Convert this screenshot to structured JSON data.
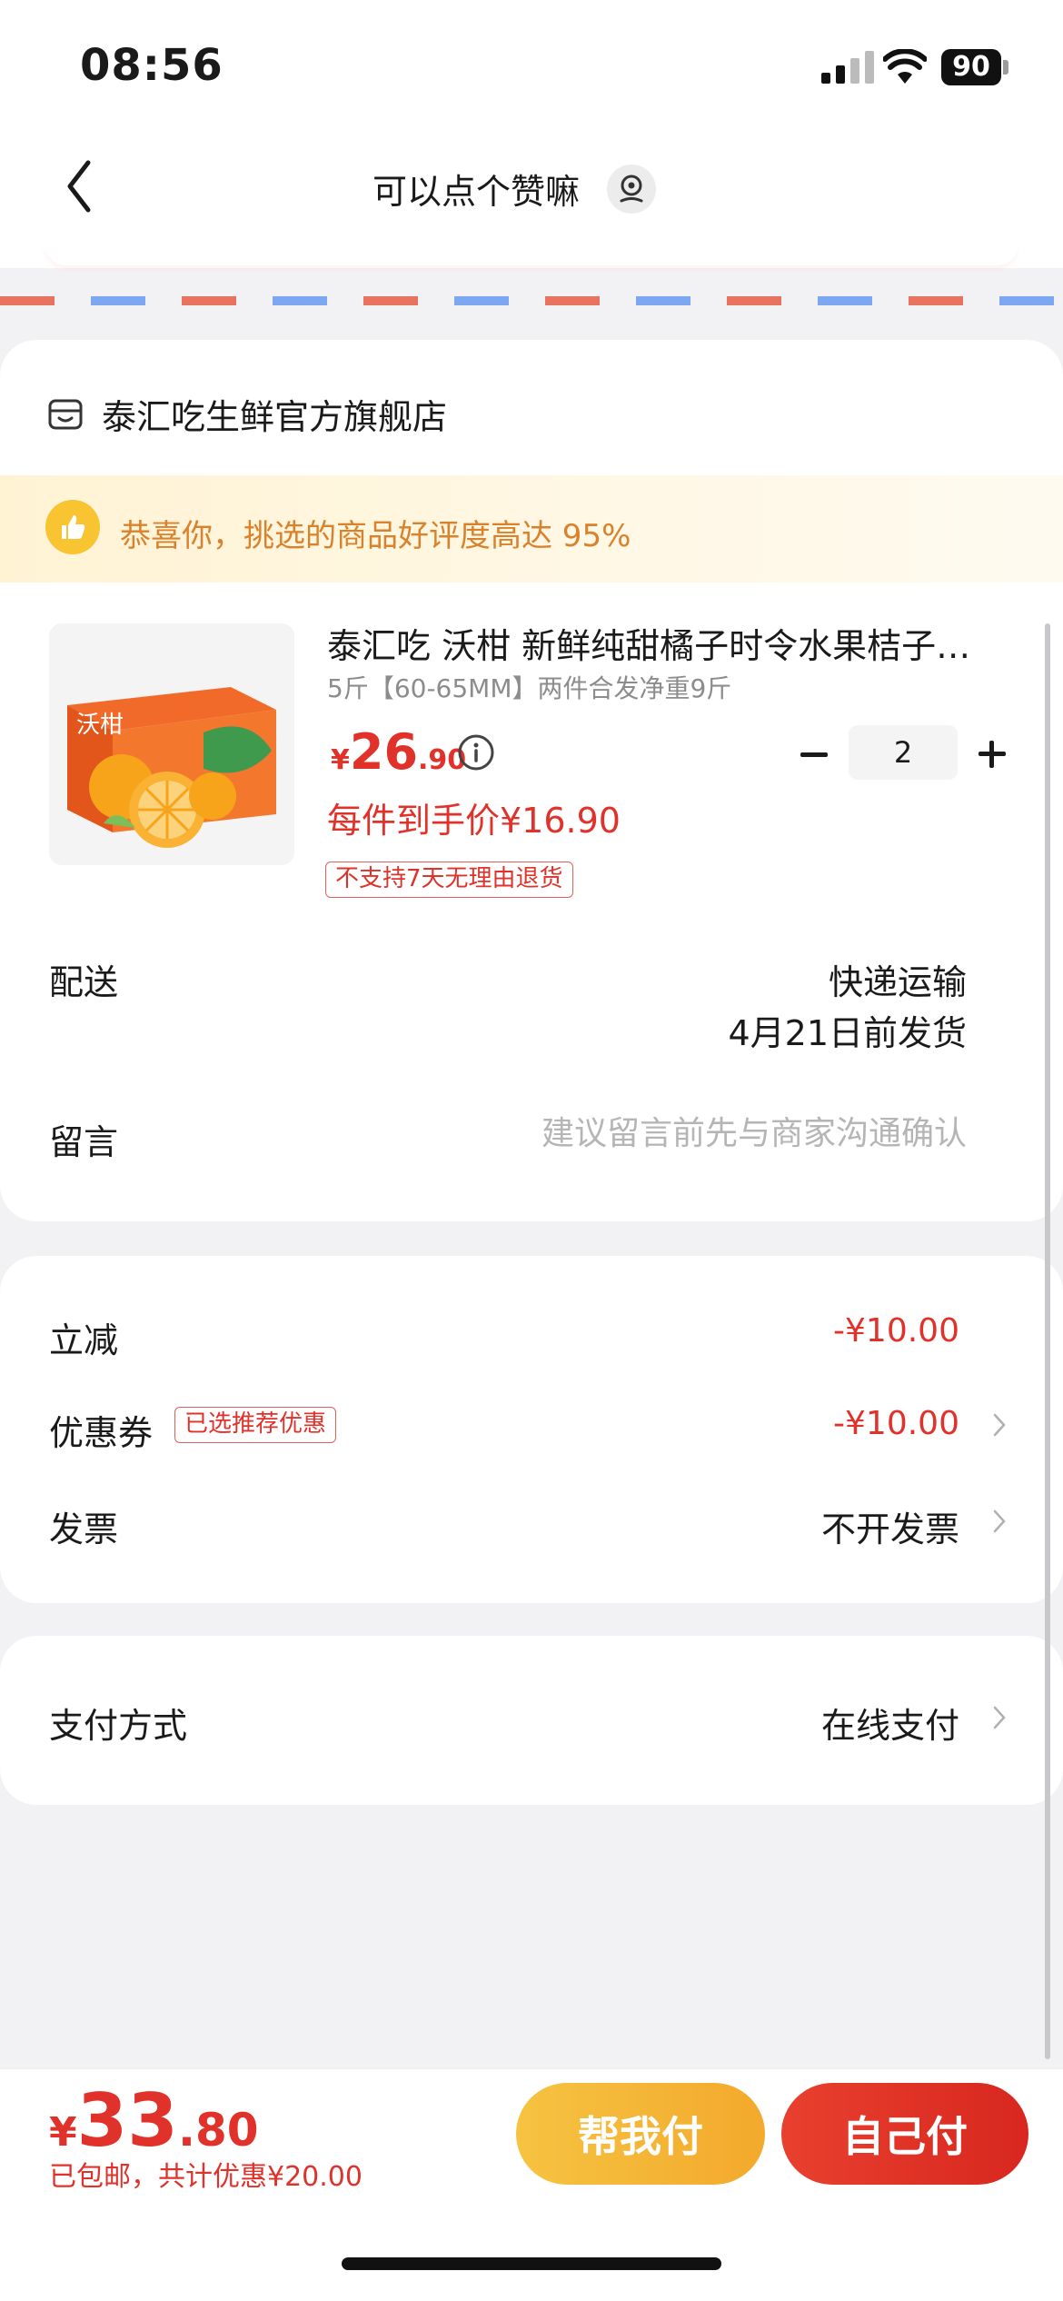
{
  "status_bar": {
    "time": "08:56",
    "battery": "90"
  },
  "nav": {
    "title": "可以点个赞嘛"
  },
  "store": {
    "name": "泰汇吃生鲜官方旗舰店"
  },
  "promo": {
    "text": "恭喜你，挑选的商品好评度高达 95%"
  },
  "product": {
    "title": "泰汇吃 沃柑 新鲜纯甜橘子时令水果桔子…",
    "spec": "5斤【60-65MM】两件合发净重9斤",
    "price_symbol": "¥",
    "price_int": "26",
    "price_dec": ".90",
    "unit_price": "每件到手价¥16.90",
    "no_return_tag": "不支持7天无理由退货",
    "quantity": "2",
    "image_text": "沃柑"
  },
  "delivery": {
    "label": "配送",
    "method": "快递运输",
    "date": "4月21日前发货"
  },
  "message": {
    "label": "留言",
    "placeholder": "建议留言前先与商家沟通确认"
  },
  "discount": {
    "label": "立减",
    "value": "-¥10.00"
  },
  "coupon": {
    "label": "优惠券",
    "tag": "已选推荐优惠",
    "value": "-¥10.00"
  },
  "invoice": {
    "label": "发票",
    "value": "不开发票"
  },
  "payment": {
    "label": "支付方式",
    "value": "在线支付"
  },
  "footer": {
    "total_symbol": "¥",
    "total_int": "33",
    "total_dec": ".80",
    "note": "已包邮，共计优惠¥20.00",
    "help_pay": "帮我付",
    "self_pay": "自己付"
  },
  "colors": {
    "accent_red": "#e0322a",
    "accent_gold": "#f6c341",
    "promo_text": "#d9822b"
  },
  "icons": [
    "back-arrow-icon",
    "location-icon",
    "store-icon",
    "thumbs-up-icon",
    "info-icon",
    "minus-icon",
    "plus-icon",
    "chevron-right-icon"
  ]
}
